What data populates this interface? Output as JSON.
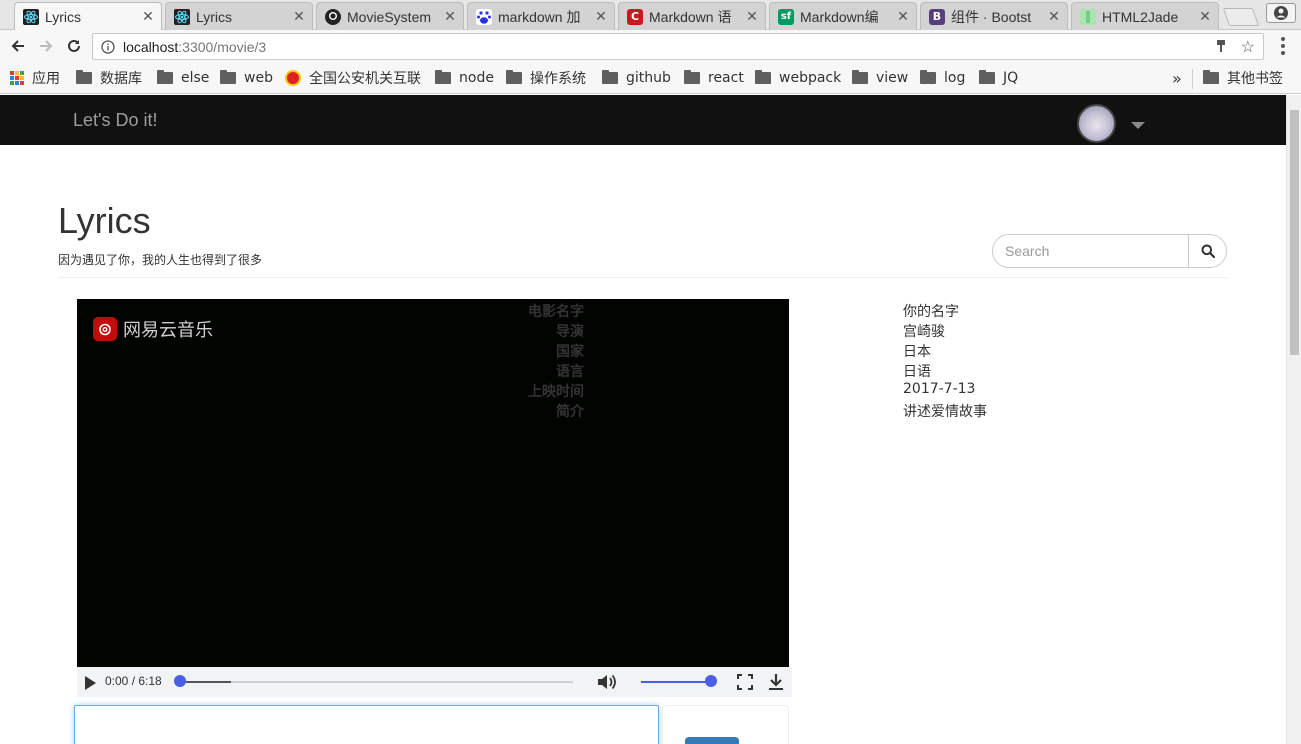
{
  "browser": {
    "tabs": [
      {
        "title": "Lyrics",
        "icon": "react-icon",
        "active": true
      },
      {
        "title": "Lyrics",
        "icon": "react-icon",
        "active": false
      },
      {
        "title": "MovieSystem",
        "icon": "github-icon",
        "active": false
      },
      {
        "title": "markdown 加",
        "icon": "baidu-icon",
        "active": false
      },
      {
        "title": "Markdown 语",
        "icon": "csdn-icon",
        "active": false
      },
      {
        "title": "Markdown编",
        "icon": "segmentfault-icon",
        "active": false
      },
      {
        "title": "组件 · Bootst",
        "icon": "bootstrap-icon",
        "active": false
      },
      {
        "title": "HTML2Jade",
        "icon": "html2jade-icon",
        "active": false
      }
    ],
    "url_host": "localhost",
    "url_path": ":3300/movie/3",
    "bookmarks": [
      {
        "label": "应用",
        "icon": "apps-icon"
      },
      {
        "label": "数据库",
        "icon": "folder-icon"
      },
      {
        "label": "else",
        "icon": "folder-icon"
      },
      {
        "label": "web",
        "icon": "folder-icon"
      },
      {
        "label": "全国公安机关互联",
        "icon": "police-emblem-icon"
      },
      {
        "label": "node",
        "icon": "folder-icon"
      },
      {
        "label": "操作系统",
        "icon": "folder-icon"
      },
      {
        "label": "github",
        "icon": "folder-icon"
      },
      {
        "label": "react",
        "icon": "folder-icon"
      },
      {
        "label": "webpack",
        "icon": "folder-icon"
      },
      {
        "label": "view",
        "icon": "folder-icon"
      },
      {
        "label": "log",
        "icon": "folder-icon"
      },
      {
        "label": "JQ",
        "icon": "folder-icon"
      }
    ],
    "overflow": "»",
    "other_bookmarks": "其他书签"
  },
  "navbar": {
    "brand": "Let's Do it!"
  },
  "header": {
    "title": "Lyrics",
    "subtitle": "因为遇见了你，我的人生也得到了很多",
    "search_placeholder": "Search"
  },
  "video": {
    "watermark": "网易云音乐",
    "time": "0:00 / 6:18",
    "progress": 0.0,
    "buffered": 0.13,
    "volume": 1.0
  },
  "movie_info": [
    {
      "label": "电影名字",
      "value": "你的名字"
    },
    {
      "label": "导演",
      "value": "宫崎骏"
    },
    {
      "label": "国家",
      "value": "日本"
    },
    {
      "label": "语言",
      "value": "日语"
    },
    {
      "label": "上映时间",
      "value": "2017-7-13"
    },
    {
      "label": "简介",
      "value": "讲述爱情故事"
    }
  ],
  "colors": {
    "navbar_bg": "#111111",
    "accent": "#4a5fe6",
    "button_primary": "#337ab7"
  }
}
